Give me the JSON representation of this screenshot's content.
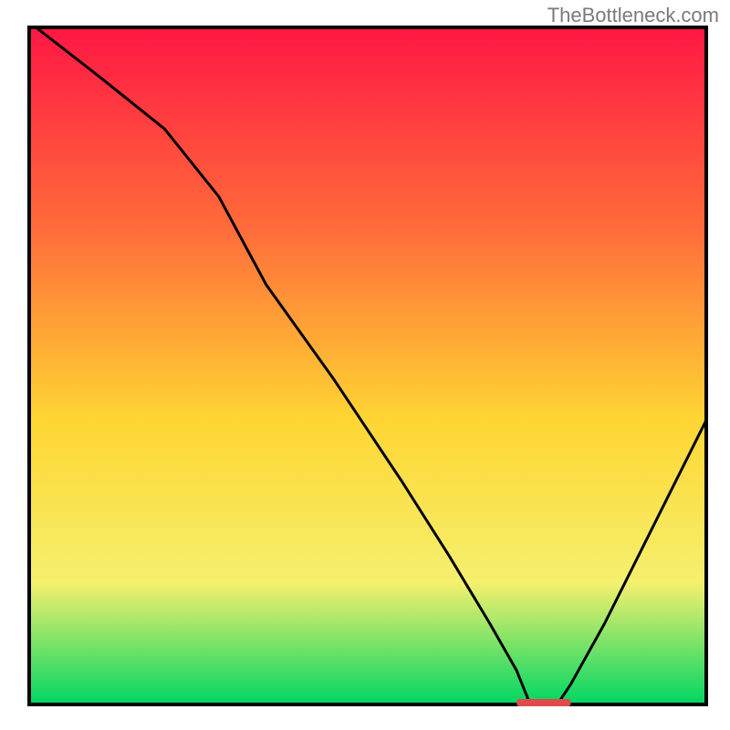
{
  "watermark": "TheBottleneck.com",
  "chart_data": {
    "type": "line",
    "title": "",
    "xlabel": "",
    "ylabel": "",
    "xlim": [
      0,
      100
    ],
    "ylim": [
      0,
      100
    ],
    "gradient_colors": {
      "top": "#ff1744",
      "upper_mid": "#ff6d3a",
      "mid": "#ffd633",
      "lower_mid": "#f5f06e",
      "bottom": "#00d663"
    },
    "series": [
      {
        "name": "bottleneck-curve",
        "x": [
          1,
          10,
          20,
          28,
          35,
          45,
          55,
          62,
          68,
          72,
          74,
          78,
          80,
          85,
          90,
          95,
          100
        ],
        "y": [
          100,
          93,
          85,
          75,
          62,
          48,
          33,
          22,
          12,
          5,
          0,
          0,
          3,
          12,
          22,
          32,
          42
        ]
      }
    ],
    "marker": {
      "name": "optimal-range",
      "x_start": 72,
      "x_end": 80,
      "y": 0,
      "color": "#e04a4a"
    }
  }
}
